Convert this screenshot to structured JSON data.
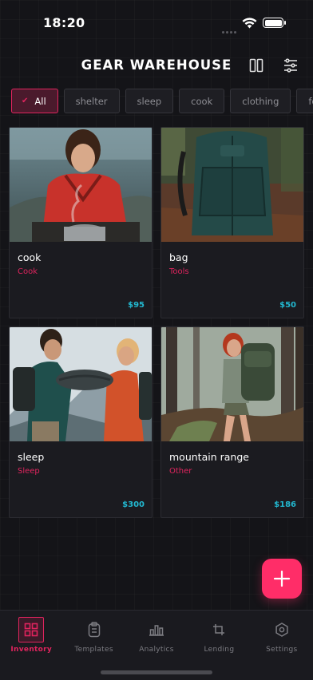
{
  "status": {
    "time": "18:20"
  },
  "header": {
    "title": "GEAR WAREHOUSE"
  },
  "chips": [
    {
      "label": "All",
      "active": true
    },
    {
      "label": "shelter"
    },
    {
      "label": "sleep"
    },
    {
      "label": "cook"
    },
    {
      "label": "clothing"
    },
    {
      "label": "footwear"
    }
  ],
  "items": [
    {
      "name": "cook",
      "category": "Cook",
      "price": "$95"
    },
    {
      "name": "bag",
      "category": "Tools",
      "price": "$50"
    },
    {
      "name": "sleep",
      "category": "Sleep",
      "price": "$300"
    },
    {
      "name": "mountain range",
      "category": "Other",
      "price": "$186"
    }
  ],
  "tabs": [
    {
      "label": "Inventory",
      "icon": "grid-icon",
      "active": true
    },
    {
      "label": "Templates",
      "icon": "clipboard-icon"
    },
    {
      "label": "Analytics",
      "icon": "bar-chart-icon"
    },
    {
      "label": "Lending",
      "icon": "crop-icon"
    },
    {
      "label": "Settings",
      "icon": "gear-icon"
    }
  ],
  "colors": {
    "accent": "#e0245e",
    "fab": "#ff2d68",
    "price": "#22b8d0",
    "background": "#141418"
  }
}
